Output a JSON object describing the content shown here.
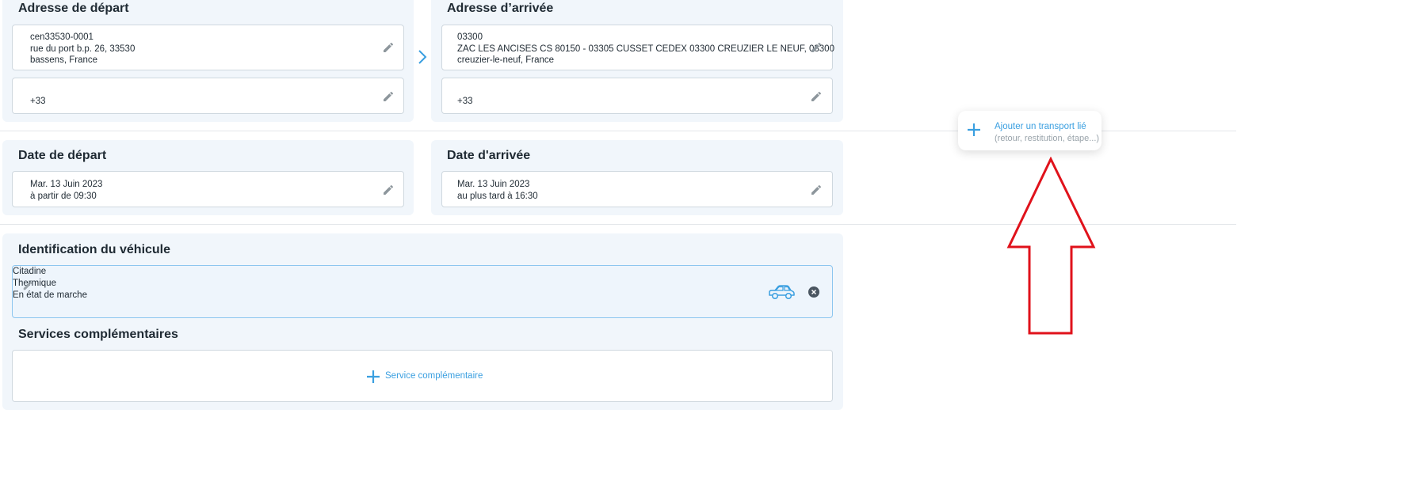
{
  "departure_address": {
    "title": "Adresse de départ",
    "address_lines": [
      "cen33530-0001",
      "rue du port b.p. 26, 33530",
      "bassens, France"
    ],
    "phone": "+33"
  },
  "arrival_address": {
    "title": "Adresse d’arrivée",
    "address_lines": [
      "03300",
      "ZAC LES ANCISES CS 80150 - 03305 CUSSET CEDEX 03300 CREUZIER LE NEUF, 03300",
      "creuzier-le-neuf, France"
    ],
    "phone": "+33"
  },
  "departure_date": {
    "title": "Date de départ",
    "lines": [
      "Mar. 13 Juin 2023",
      "à partir de 09:30"
    ]
  },
  "arrival_date": {
    "title": "Date d'arrivée",
    "lines": [
      "Mar. 13 Juin 2023",
      "au plus tard à 16:30"
    ]
  },
  "linked_transport": {
    "label": "Ajouter un transport lié",
    "hint": "(retour, restitution, étape...)"
  },
  "vehicle": {
    "title": "Identification du véhicule",
    "lines": [
      "Citadine",
      "Thermique",
      "En état de marche"
    ]
  },
  "services": {
    "title": "Services complémentaires",
    "add_label": "Service complémentaire"
  },
  "colors": {
    "accent": "#3a9fe0",
    "panel_bg": "#f1f6fb",
    "annotation_arrow": "#e0121b"
  },
  "icons": [
    "pencil-icon",
    "chevron-right-icon",
    "plus-icon",
    "car-icon",
    "close-circle-icon",
    "up-arrow-annotation"
  ]
}
